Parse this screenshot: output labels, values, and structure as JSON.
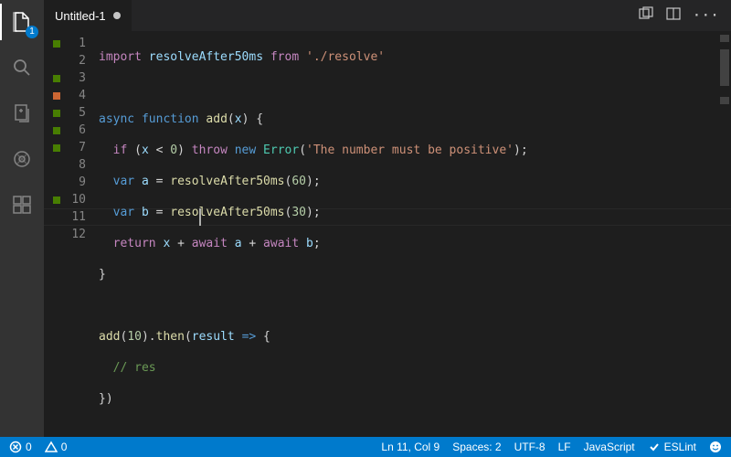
{
  "activity": {
    "explorer_badge": "1"
  },
  "tab": {
    "title": "Untitled-1",
    "dirty": true
  },
  "gutter": [
    {
      "n": "1",
      "c": "green"
    },
    {
      "n": "2",
      "c": ""
    },
    {
      "n": "3",
      "c": "green"
    },
    {
      "n": "4",
      "c": "orange"
    },
    {
      "n": "5",
      "c": "green"
    },
    {
      "n": "6",
      "c": "green"
    },
    {
      "n": "7",
      "c": "green"
    },
    {
      "n": "8",
      "c": ""
    },
    {
      "n": "9",
      "c": ""
    },
    {
      "n": "10",
      "c": "green"
    },
    {
      "n": "11",
      "c": ""
    },
    {
      "n": "12",
      "c": ""
    }
  ],
  "code": {
    "l1": {
      "t1": "import",
      "t2": " resolveAfter50ms ",
      "t3": "from",
      "t4": " ",
      "t5": "'./resolve'"
    },
    "l3": {
      "t1": "async",
      "t2": " ",
      "t3": "function",
      "t4": " ",
      "t5": "add",
      "t6": "(",
      "t7": "x",
      "t8": ") {"
    },
    "l4": {
      "t1": "  ",
      "t2": "if",
      "t3": " (",
      "t4": "x",
      "t5": " < ",
      "t6": "0",
      "t7": ") ",
      "t8": "throw",
      "t9": " ",
      "t10": "new",
      "t11": " ",
      "t12": "Error",
      "t13": "(",
      "t14": "'The number must be positive'",
      "t15": ");"
    },
    "l5": {
      "t1": "  ",
      "t2": "var",
      "t3": " ",
      "t4": "a",
      "t5": " = ",
      "t6": "resolveAfter50ms",
      "t7": "(",
      "t8": "60",
      "t9": ");"
    },
    "l6": {
      "t1": "  ",
      "t2": "var",
      "t3": " ",
      "t4": "b",
      "t5": " = ",
      "t6": "resolveAfter50ms",
      "t7": "(",
      "t8": "30",
      "t9": ");"
    },
    "l7": {
      "t1": "  ",
      "t2": "return",
      "t3": " ",
      "t4": "x",
      "t5": " + ",
      "t6": "await",
      "t7": " ",
      "t8": "a",
      "t9": " + ",
      "t10": "await",
      "t11": " ",
      "t12": "b",
      "t13": ";"
    },
    "l8": {
      "t1": "}"
    },
    "l10": {
      "t1": "add",
      "t2": "(",
      "t3": "10",
      "t4": ").",
      "t5": "then",
      "t6": "(",
      "t7": "result",
      "t8": " ",
      "t9": "=>",
      "t10": " {"
    },
    "l11": {
      "t1": "  ",
      "t2": "// res"
    },
    "l12": {
      "t1": "})"
    }
  },
  "status": {
    "errors": "0",
    "warnings": "0",
    "cursor": "Ln 11, Col 9",
    "spaces": "Spaces: 2",
    "encoding": "UTF-8",
    "eol": "LF",
    "lang": "JavaScript",
    "eslint": "ESLint"
  }
}
